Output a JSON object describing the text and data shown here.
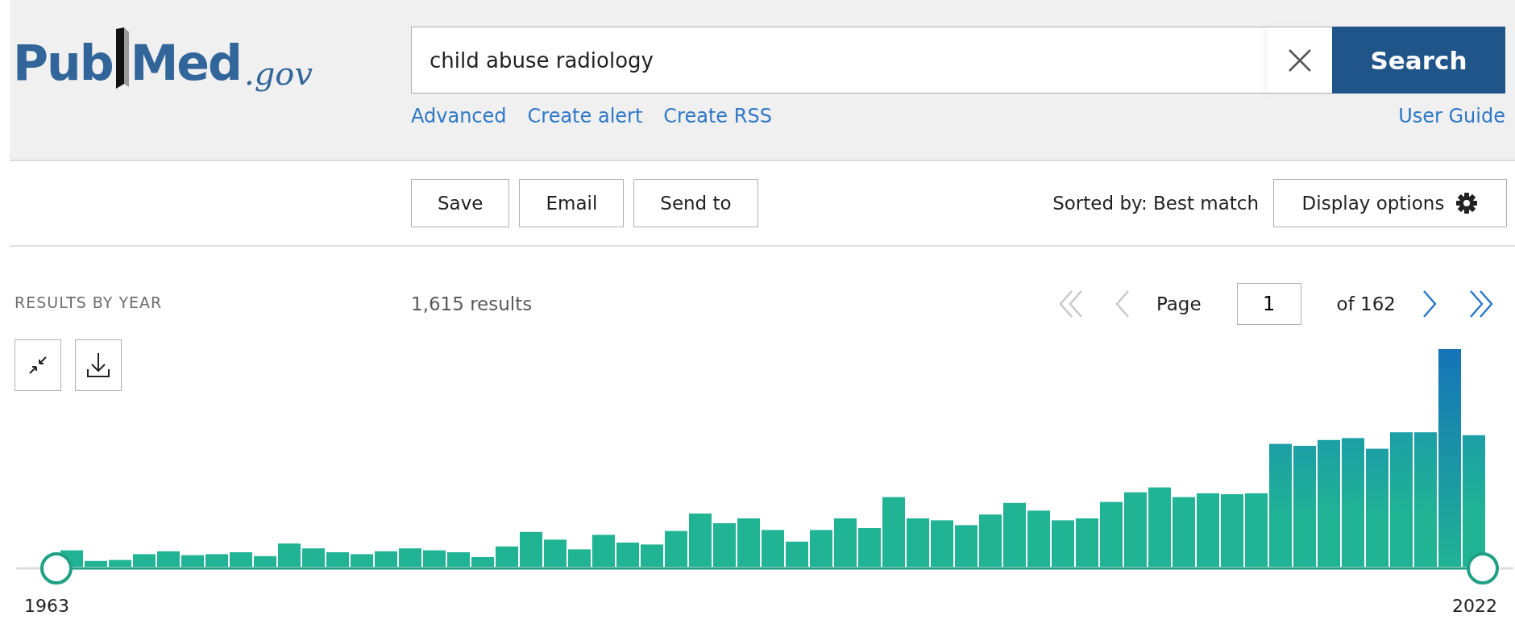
{
  "logo": {
    "left": "Pub",
    "right": "Med",
    "suffix": ".gov"
  },
  "search": {
    "value": "child abuse radiology",
    "button": "Search"
  },
  "search_links": [
    "Advanced",
    "Create alert",
    "Create RSS"
  ],
  "user_guide": "User Guide",
  "actions": [
    "Save",
    "Email",
    "Send to"
  ],
  "sort": "Sorted by: Best match",
  "display_options": "Display options",
  "timeline": {
    "title": "RESULTS BY YEAR",
    "start_year": "1963",
    "end_year": "2022"
  },
  "results_count": "1,615 results",
  "pagination": {
    "label": "Page",
    "value": "1",
    "total": "of 162",
    "buttons": [
      {
        "kind": "first",
        "disabled": true
      },
      {
        "kind": "prev",
        "disabled": true
      },
      {
        "kind": "next",
        "disabled": false
      },
      {
        "kind": "last",
        "disabled": false
      }
    ]
  }
}
